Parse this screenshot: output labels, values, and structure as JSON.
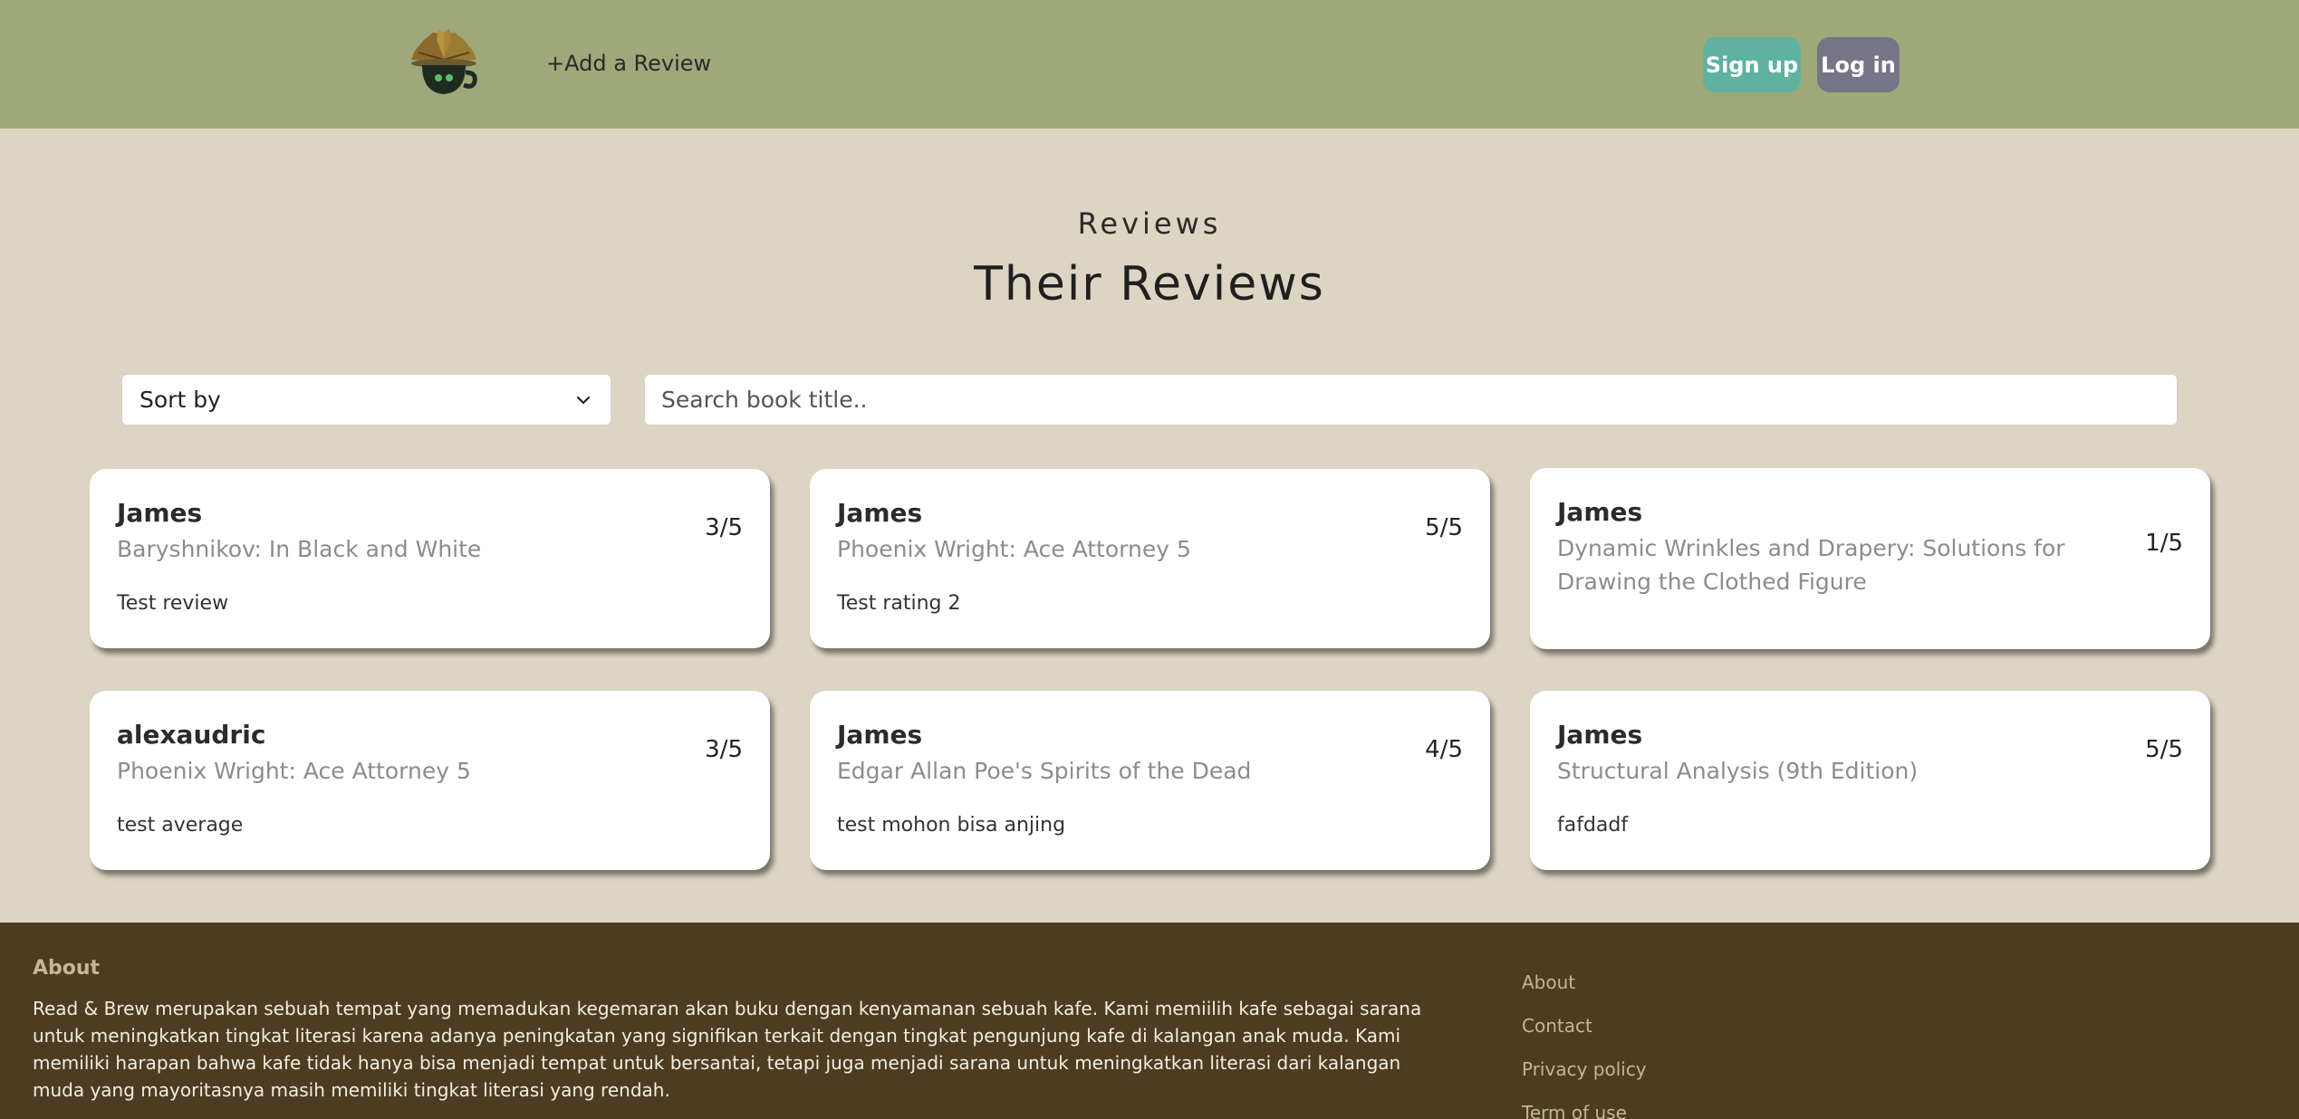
{
  "header": {
    "nav_add_review": "+Add a Review",
    "signup_label": "Sign up",
    "login_label": "Log in"
  },
  "page": {
    "subtitle": "Reviews",
    "title": "Their Reviews"
  },
  "controls": {
    "sort_label": "Sort by",
    "search_placeholder": "Search book title.."
  },
  "reviews": [
    {
      "user": "James",
      "book": "Baryshnikov: In Black and White",
      "rating": "3/5",
      "text": "Test review"
    },
    {
      "user": "James",
      "book": "Phoenix Wright: Ace Attorney 5",
      "rating": "5/5",
      "text": "Test rating 2"
    },
    {
      "user": "James",
      "book": "Dynamic Wrinkles and Drapery: Solutions for Drawing the Clothed Figure",
      "rating": "1/5",
      "text": ""
    },
    {
      "user": "alexaudric",
      "book": "Phoenix Wright: Ace Attorney 5",
      "rating": "3/5",
      "text": "test average"
    },
    {
      "user": "James",
      "book": "Edgar Allan Poe's Spirits of the Dead",
      "rating": "4/5",
      "text": "test mohon bisa anjing"
    },
    {
      "user": "James",
      "book": "Structural Analysis (9th Edition)",
      "rating": "5/5",
      "text": "fafdadf"
    }
  ],
  "footer": {
    "heading": "About",
    "about_text": "Read & Brew merupakan sebuah tempat yang memadukan kegemaran akan buku dengan kenyamanan sebuah kafe. Kami memiilih kafe sebagai sarana untuk meningkatkan tingkat literasi karena adanya peningkatan yang signifikan terkait dengan tingkat pengunjung kafe di kalangan anak muda. Kami memiliki harapan bahwa kafe tidak hanya bisa menjadi tempat untuk bersantai, tetapi juga menjadi sarana untuk meningkatkan literasi dari kalangan muda yang mayoritasnya masih memiliki tingkat literasi yang rendah.",
    "links": [
      "About",
      "Contact",
      "Privacy policy",
      "Term of use"
    ]
  },
  "colors": {
    "header_bg": "#9ea879",
    "page_bg": "#dcd5c3",
    "signup_bg": "#5fb1a0",
    "login_bg": "#757587",
    "footer_bg": "#4d3c21"
  }
}
